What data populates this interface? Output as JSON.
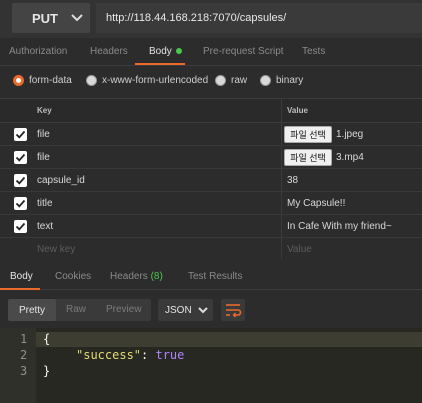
{
  "request": {
    "method": "PUT",
    "url": "http://118.44.168.218:7070/capsules/"
  },
  "tabs": [
    {
      "label": "Authorization"
    },
    {
      "label": "Headers"
    },
    {
      "label": "Body"
    },
    {
      "label": "Pre-request Script"
    },
    {
      "label": "Tests"
    }
  ],
  "body_types": [
    {
      "label": "form-data",
      "selected": true
    },
    {
      "label": "x-www-form-urlencoded",
      "selected": false
    },
    {
      "label": "raw",
      "selected": false
    },
    {
      "label": "binary",
      "selected": false
    }
  ],
  "table": {
    "headers": {
      "key": "Key",
      "value": "Value"
    },
    "rows": [
      {
        "key": "file",
        "value": "",
        "file_button": "파일 선택",
        "file_name": "1.jpeg"
      },
      {
        "key": "file",
        "value": "",
        "file_button": "파일 선택",
        "file_name": "3.mp4"
      },
      {
        "key": "capsule_id",
        "value": "38"
      },
      {
        "key": "title",
        "value": "My Capsule!!"
      },
      {
        "key": "text",
        "value": "In Cafe With my friend~"
      }
    ],
    "new_row": {
      "key_placeholder": "New key",
      "value_placeholder": "Value"
    }
  },
  "response": {
    "tabs": [
      {
        "label": "Body"
      },
      {
        "label": "Cookies"
      },
      {
        "label": "Headers",
        "count": "(8)"
      },
      {
        "label": "Test Results"
      }
    ],
    "view_modes": [
      "Pretty",
      "Raw",
      "Preview"
    ],
    "format": "JSON",
    "line_numbers": [
      "1",
      "2",
      "3"
    ],
    "code": {
      "open": "{",
      "key": "\"success\"",
      "colon": ": ",
      "value": "true",
      "close": "}"
    }
  },
  "colors": {
    "accent": "#e96a2a",
    "success": "#4bc84b"
  }
}
